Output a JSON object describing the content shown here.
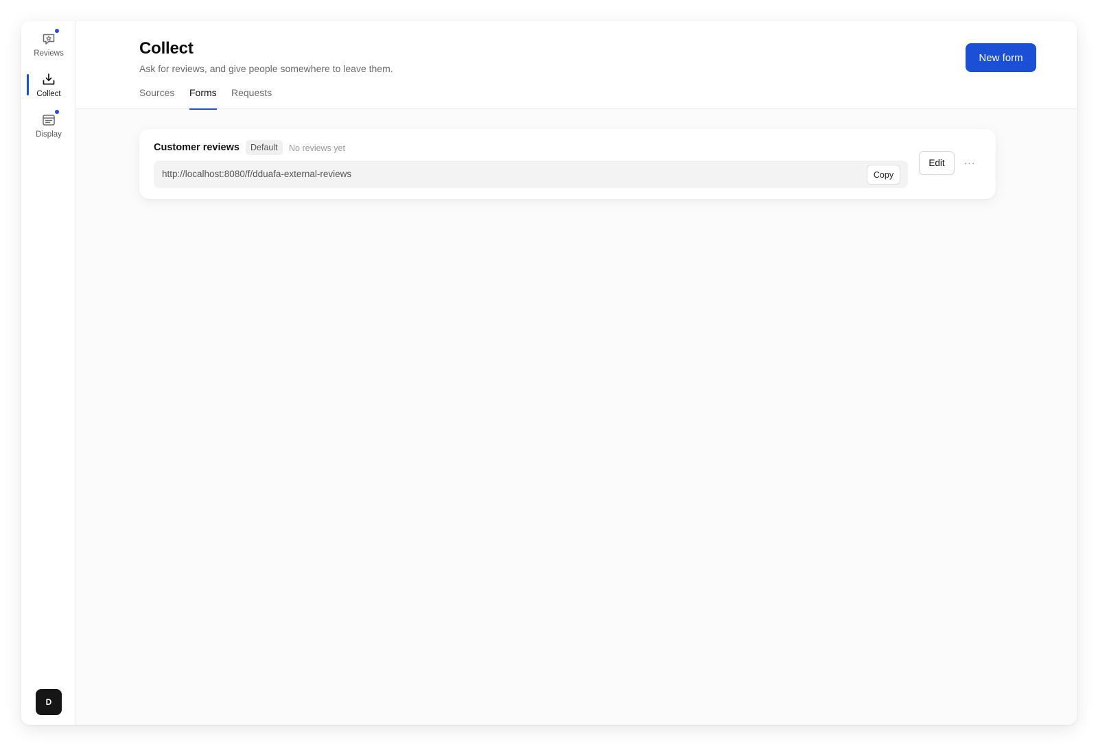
{
  "sidebar": {
    "items": [
      {
        "label": "Reviews",
        "icon": "chat-star-icon",
        "has_dot": true
      },
      {
        "label": "Collect",
        "icon": "download-tray-icon",
        "active": true
      },
      {
        "label": "Display",
        "icon": "browser-window-icon",
        "has_dot": true
      }
    ],
    "avatar_initial": "D"
  },
  "header": {
    "title": "Collect",
    "subtitle": "Ask for reviews, and give people somewhere to leave them.",
    "new_form_label": "New form",
    "tabs": [
      {
        "label": "Sources"
      },
      {
        "label": "Forms",
        "active": true
      },
      {
        "label": "Requests"
      }
    ]
  },
  "forms": [
    {
      "name": "Customer reviews",
      "badge": "Default",
      "meta": "No reviews yet",
      "url": "http://localhost:8080/f/dduafa-external-reviews",
      "copy_label": "Copy",
      "edit_label": "Edit",
      "more_label": "···"
    }
  ],
  "colors": {
    "accent": "#1a4fd6",
    "avatar_bg": "#161616",
    "page_bg": "#fbfbfb"
  }
}
